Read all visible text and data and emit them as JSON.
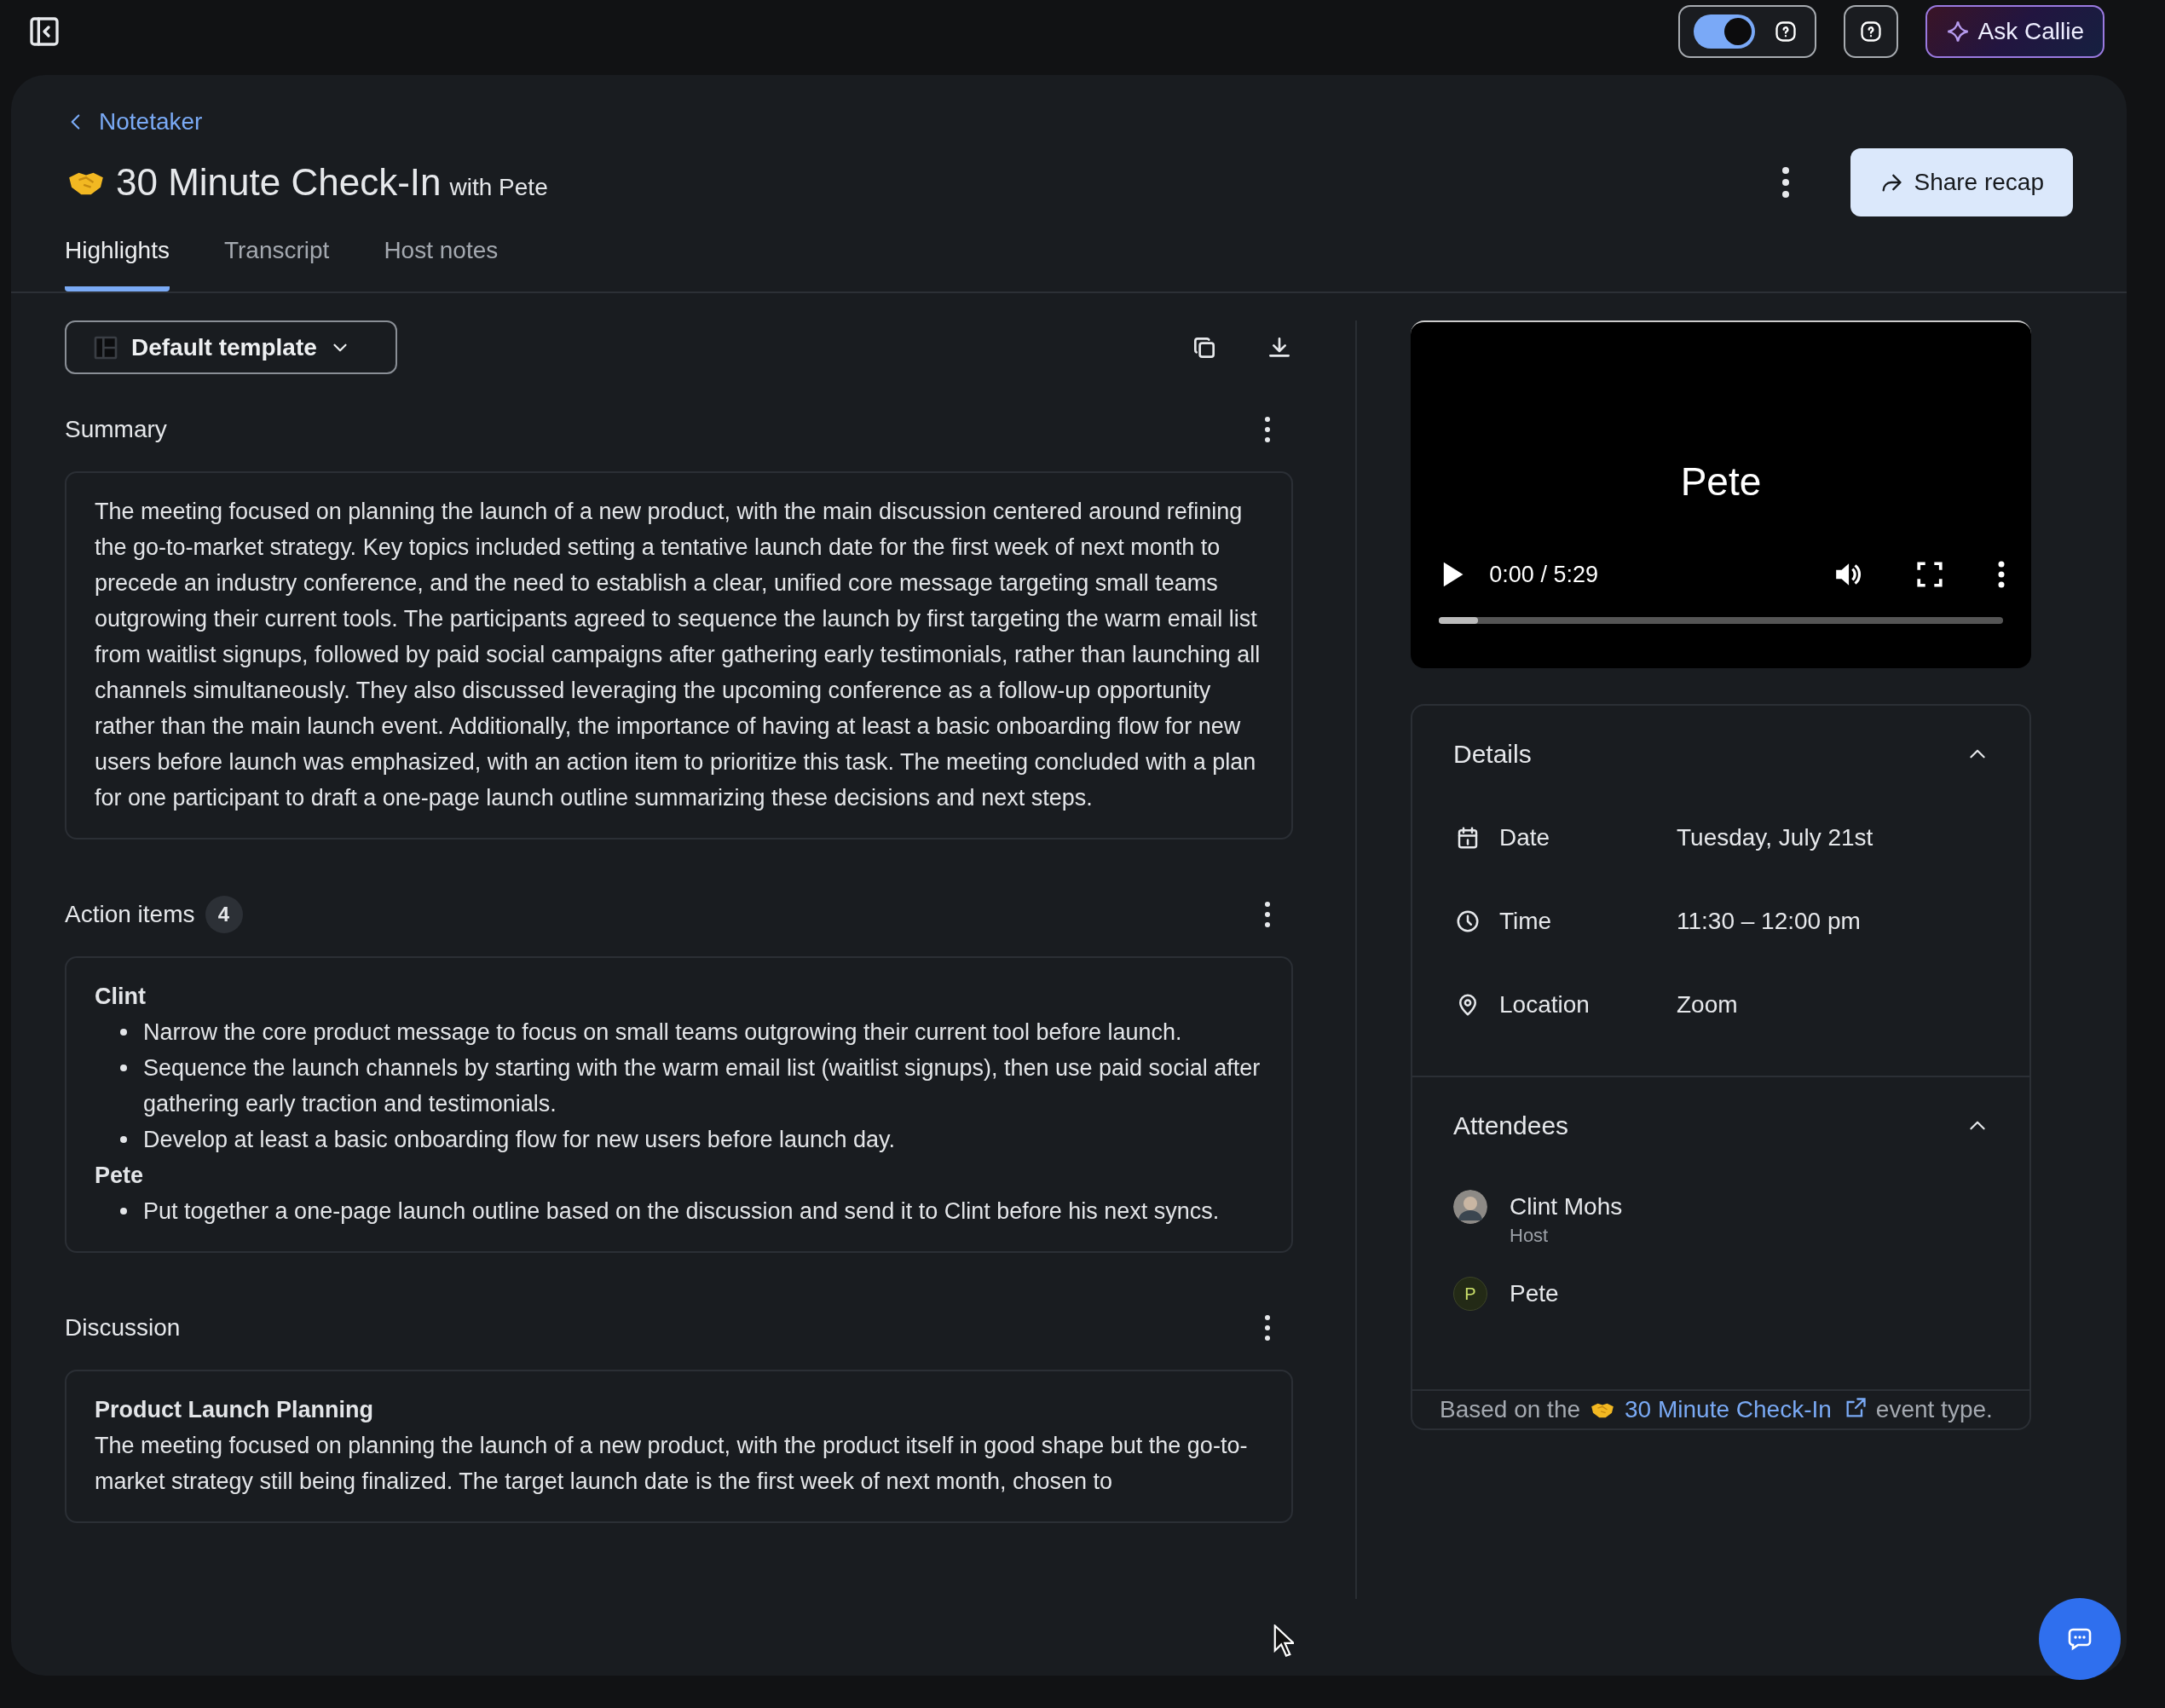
{
  "top_bar": {
    "toggle": {
      "on": true
    },
    "ask_button": "Ask Callie"
  },
  "header": {
    "back_link": "Notetaker",
    "title": "30 Minute Check-In",
    "subtitle": "with Pete",
    "share_button": "Share recap"
  },
  "tabs": [
    {
      "label": "Highlights",
      "selected": true
    },
    {
      "label": "Transcript",
      "selected": false
    },
    {
      "label": "Host notes",
      "selected": false
    }
  ],
  "template_dropdown": "Default template",
  "sections": [
    {
      "kind": "summary",
      "title": "Summary",
      "paragraph": "The meeting focused on planning the launch of a new product, with the main discussion centered around refining the go-to-market strategy. Key topics included setting a tentative launch date for the first week of next month to precede an industry conference, and the need to establish a clear, unified core message targeting small teams outgrowing their current tools. The participants agreed to sequence the launch by first targeting the warm email list from waitlist signups, followed by paid social campaigns after gathering early testimonials, rather than launching all channels simultaneously. They also discussed leveraging the upcoming conference as a follow-up opportunity rather than the main launch event. Additionally, the importance of having at least a basic onboarding flow for new users before launch was emphasized, with an action item to prioritize this task. The meeting concluded with a plan for one participant to draft a one-page launch outline summarizing these decisions and next steps."
    },
    {
      "kind": "action_items",
      "title": "Action items",
      "count": "4",
      "groups": [
        {
          "person": "Clint",
          "items": [
            "Narrow the core product message to focus on small teams outgrowing their current tool before launch.",
            "Sequence the launch channels by starting with the warm email list (waitlist signups), then use paid social after gathering early traction and testimonials.",
            "Develop at least a basic onboarding flow for new users before launch day."
          ]
        },
        {
          "person": "Pete",
          "items": [
            "Put together a one-page launch outline based on the discussion and send it to Clint before his next syncs."
          ]
        }
      ]
    },
    {
      "kind": "discussion",
      "title": "Discussion",
      "topics": [
        {
          "heading": "Product Launch Planning",
          "text": "The meeting focused on planning the launch of a new product, with the product itself in good shape but the go-to-market strategy still being finalized. The target launch date is the first week of next month, chosen to"
        }
      ]
    }
  ],
  "video": {
    "caption": "Pete",
    "time": "0:00 / 5:29",
    "level": 0.07
  },
  "details": {
    "title": "Details",
    "expanded": true,
    "rows": [
      {
        "kind": "date",
        "label": "Date",
        "value": "Tuesday, July 21st"
      },
      {
        "kind": "time",
        "label": "Time",
        "value": "11:30 – 12:00 pm"
      },
      {
        "kind": "location",
        "label": "Location",
        "value": "Zoom"
      }
    ]
  },
  "attendees": {
    "title": "Attendees",
    "expanded": true,
    "people": [
      {
        "kind": "photo",
        "name": "Clint Mohs",
        "role": "Host"
      },
      {
        "kind": "initial",
        "name": "Pete",
        "initial": "P"
      }
    ]
  },
  "footer_note": {
    "before": "Based on the",
    "link": "30 Minute Check-In",
    "after": "event type."
  }
}
